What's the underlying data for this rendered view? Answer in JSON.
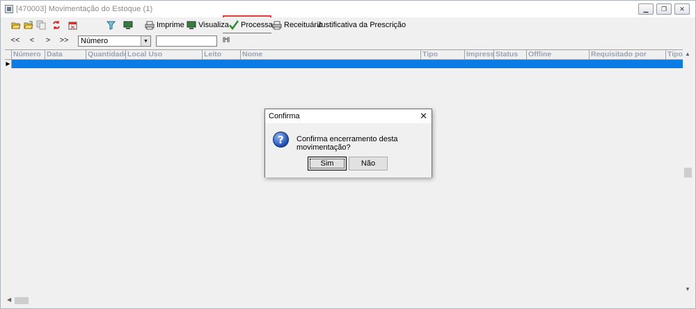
{
  "window": {
    "title": "[470003]  Movimentação do Estoque (1)"
  },
  "toolbar": {
    "imprime": "Imprime",
    "visualiza": "Visualiza",
    "processa": "Processa",
    "receituario": "Receituário",
    "justificativa": "Justificativa da Prescrição"
  },
  "navbar": {
    "first": "<<",
    "prev": "<",
    "next": ">",
    "last": ">>",
    "search_field_selected": "Número",
    "search_value": ""
  },
  "grid": {
    "columns": [
      "Número",
      "Data",
      "Quantidade",
      "Local Uso",
      "Leito",
      "Nome",
      "Tipo",
      "Impressa",
      "Status",
      "Offline",
      "Requisitado por",
      "Tipo"
    ]
  },
  "dialog": {
    "title": "Confirma",
    "message": "Confirma encerramento desta movimentação?",
    "yes": "Sim",
    "no": "Não"
  },
  "colors": {
    "selection": "#0b7be6",
    "highlight_border": "#e2403a"
  }
}
